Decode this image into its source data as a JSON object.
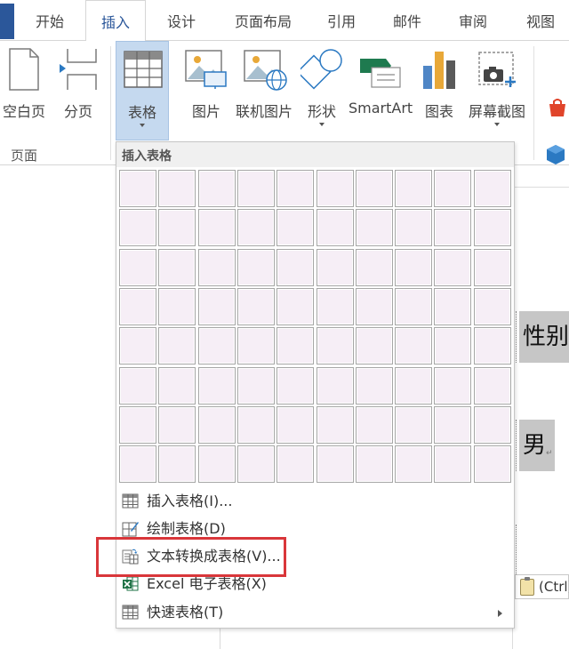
{
  "tabs": [
    {
      "label": "开始",
      "active": false
    },
    {
      "label": "插入",
      "active": true
    },
    {
      "label": "设计",
      "active": false
    },
    {
      "label": "页面布局",
      "active": false
    },
    {
      "label": "引用",
      "active": false
    },
    {
      "label": "邮件",
      "active": false
    },
    {
      "label": "审阅",
      "active": false
    },
    {
      "label": "视图",
      "active": false
    }
  ],
  "ribbon": {
    "pages_group": {
      "label": "页面",
      "blank_page": "空白页",
      "page_break": "分页"
    },
    "table_button": "表格",
    "pictures": "图片",
    "online_pictures": "联机图片",
    "shapes": "形状",
    "smartart": "SmartArt",
    "chart": "图表",
    "screenshot": "屏幕截图"
  },
  "insert_table_menu": {
    "header": "插入表格",
    "grid": {
      "columns": 10,
      "rows": 8
    },
    "items": [
      {
        "label": "插入表格(I)...",
        "icon": "insert-table-icon"
      },
      {
        "label": "绘制表格(D)",
        "icon": "draw-table-icon"
      },
      {
        "label": "文本转换成表格(V)...",
        "icon": "text-to-table-icon",
        "highlighted": true
      },
      {
        "label": "Excel 电子表格(X)",
        "icon": "excel-icon"
      },
      {
        "label": "快速表格(T)",
        "icon": "quick-tables-icon",
        "submenu": true
      }
    ]
  },
  "document": {
    "cell_gender": "性别",
    "cell_male": "男",
    "paste_options": "(Ctrl)"
  },
  "colors": {
    "accent": "#2b579a",
    "selected_button": "#c5d9ef",
    "grid_cell": "#f6eef6",
    "highlight_border": "#d9363a",
    "table_shading": "#c6c6c6"
  }
}
